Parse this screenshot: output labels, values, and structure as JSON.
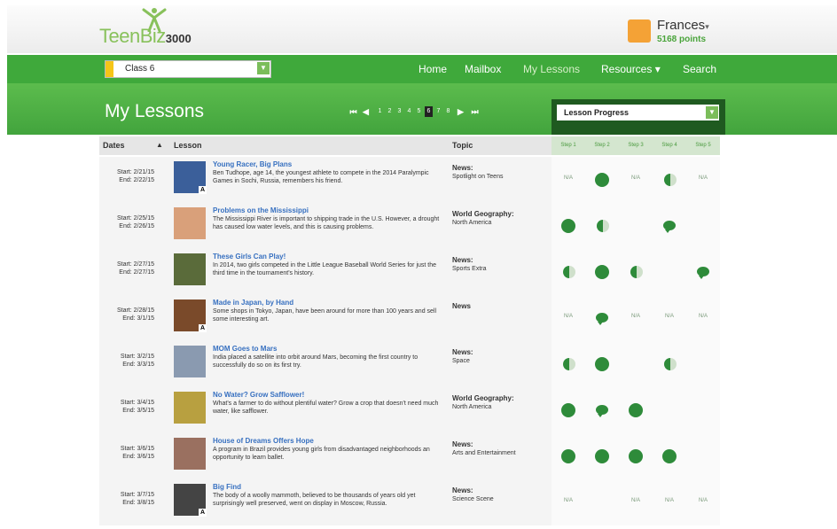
{
  "app": {
    "logo_text": "TeenBiz",
    "logo_number": "3000"
  },
  "user": {
    "name": "Frances",
    "caret": "▾",
    "points": "5168 points"
  },
  "nav": {
    "class_select": "Class 6",
    "links": [
      "Home",
      "Mailbox",
      "My Lessons",
      "Resources ▾",
      "Search"
    ]
  },
  "page": {
    "title": "My Lessons"
  },
  "pager": {
    "first": "⏮",
    "prev": "◀",
    "pages": [
      "1",
      "2",
      "3",
      "4",
      "5",
      "6",
      "7",
      "8"
    ],
    "current": "6",
    "next": "▶",
    "last": "⏭"
  },
  "progress_filter": {
    "selected": "Lesson Progress"
  },
  "table": {
    "headers": {
      "dates": "Dates",
      "sort": "▲",
      "lesson": "Lesson",
      "topic": "Topic"
    },
    "steps": [
      "Step 1",
      "Step 2",
      "Step 3",
      "Step 4",
      "Step 5"
    ],
    "na_label": "N/A",
    "rows": [
      {
        "start": "Start: 2/21/15",
        "end": "End: 2/22/15",
        "title": "Young Racer, Big Plans",
        "desc": "Ben Tudhope, age 14, the youngest athlete to compete in the 2014 Paralympic Games in Sochi, Russia, remembers his friend.",
        "topic_main": "News:",
        "topic_sub": "Spotlight on Teens",
        "thumb_color": "#3b5f9a",
        "has_a": true,
        "steps": [
          "na",
          "full",
          "na",
          "half",
          "na"
        ]
      },
      {
        "start": "Start: 2/25/15",
        "end": "End: 2/26/15",
        "title": "Problems on the Mississippi",
        "desc": "The Mississippi River is important to shipping trade in the U.S. However, a drought has caused low water levels, and this is causing problems.",
        "topic_main": "World Geography:",
        "topic_sub": "North America",
        "thumb_color": "#d9a07a",
        "has_a": false,
        "steps": [
          "full",
          "half",
          "",
          "bubble",
          ""
        ]
      },
      {
        "start": "Start: 2/27/15",
        "end": "End: 2/27/15",
        "title": "These Girls Can Play!",
        "desc": "In 2014, two girls competed in the Little League Baseball World Series for just the third time in the tournament's history.",
        "topic_main": "News:",
        "topic_sub": "Sports Extra",
        "thumb_color": "#5a6b3a",
        "has_a": false,
        "steps": [
          "half",
          "full",
          "half",
          "",
          "bubble"
        ]
      },
      {
        "start": "Start: 2/28/15",
        "end": "End: 3/1/15",
        "title": "Made in Japan, by Hand",
        "desc": "Some shops in Tokyo, Japan, have been around for more than 100 years and sell some interesting art.",
        "topic_main": "News",
        "topic_sub": "",
        "thumb_color": "#7a4a2a",
        "has_a": true,
        "steps": [
          "na",
          "bubble",
          "na",
          "na",
          "na"
        ]
      },
      {
        "start": "Start: 3/2/15",
        "end": "End: 3/3/15",
        "title": "MOM Goes to Mars",
        "desc": "India placed a satellite into orbit around Mars, becoming the first country to successfully do so on its first try.",
        "topic_main": "News:",
        "topic_sub": "Space",
        "thumb_color": "#8a9ab0",
        "has_a": false,
        "steps": [
          "half",
          "full",
          "",
          "half",
          ""
        ]
      },
      {
        "start": "Start: 3/4/15",
        "end": "End: 3/5/15",
        "title": "No Water? Grow Safflower!",
        "desc": "What's a farmer to do without plentiful water? Grow a crop that doesn't need much water, like safflower.",
        "topic_main": "World Geography:",
        "topic_sub": "North America",
        "thumb_color": "#b8a040",
        "has_a": false,
        "steps": [
          "full",
          "bubble",
          "full",
          "",
          ""
        ]
      },
      {
        "start": "Start: 3/6/15",
        "end": "End: 3/6/15",
        "title": "House of Dreams Offers Hope",
        "desc": "A program in Brazil provides young girls from disadvantaged neighborhoods an opportunity to learn ballet.",
        "topic_main": "News:",
        "topic_sub": "Arts and Entertainment",
        "thumb_color": "#9a7060",
        "has_a": false,
        "steps": [
          "full",
          "full",
          "full",
          "full",
          ""
        ]
      },
      {
        "start": "Start: 3/7/15",
        "end": "End: 3/8/15",
        "title": "Big Find",
        "desc": "The body of a woolly mammoth, believed to be thousands of years old yet surprisingly well preserved, went on display in Moscow, Russia.",
        "topic_main": "News:",
        "topic_sub": "Science Scene",
        "thumb_color": "#444444",
        "has_a": true,
        "steps": [
          "na",
          "",
          "na",
          "na",
          "na"
        ]
      }
    ]
  },
  "colors": {
    "brand_green": "#3fa93b",
    "progress_green": "#2e8b3a",
    "link_blue": "#3770c0"
  }
}
